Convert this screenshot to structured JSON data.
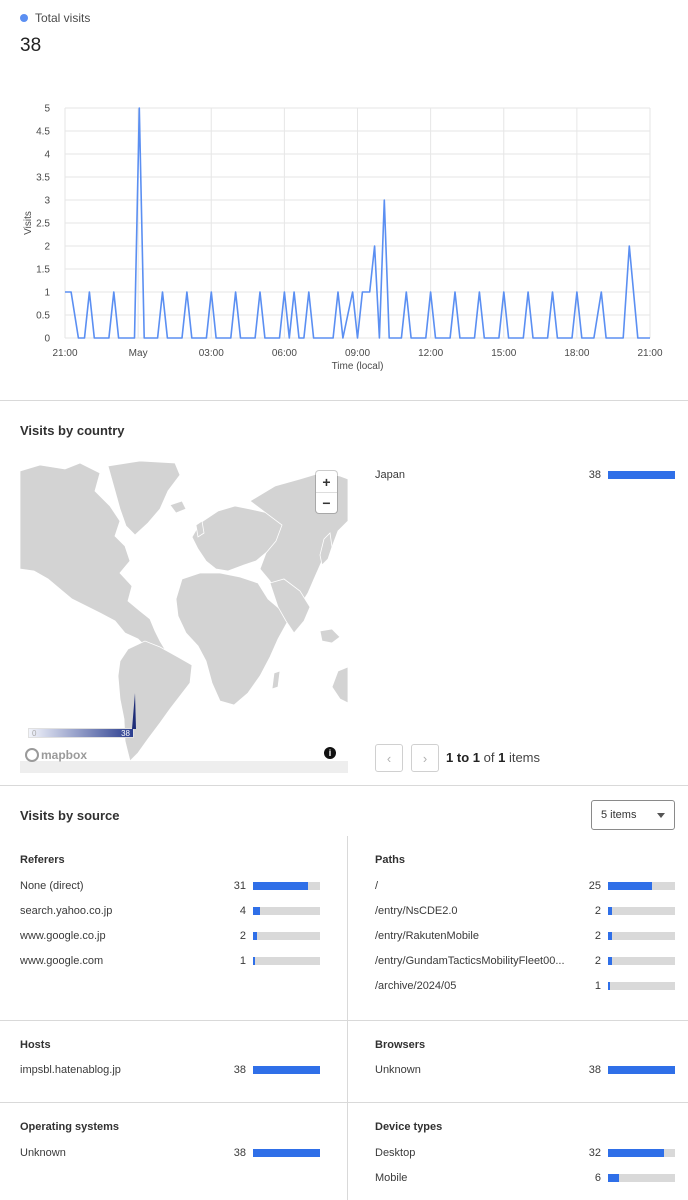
{
  "summary": {
    "legend_label": "Total visits",
    "total": "38",
    "accent": "#5b8ff2"
  },
  "chart_data": {
    "type": "line",
    "title": "",
    "xlabel": "Time (local)",
    "ylabel": "Visits",
    "ylim": [
      0,
      5
    ],
    "yticks": [
      "0",
      "0.5",
      "1",
      "1.5",
      "2",
      "2.5",
      "3",
      "3.5",
      "4",
      "4.5",
      "5"
    ],
    "xticks": [
      "21:00",
      "May",
      "03:00",
      "06:00",
      "09:00",
      "12:00",
      "15:00",
      "18:00",
      "21:00"
    ],
    "xrange_hours": [
      0,
      24
    ],
    "grid": true,
    "series": [
      {
        "color": "#5b8ff2",
        "points": [
          [
            0,
            1
          ],
          [
            0.25,
            1
          ],
          [
            0.55,
            0
          ],
          [
            0.8,
            0
          ],
          [
            1.0,
            1
          ],
          [
            1.2,
            0
          ],
          [
            1.8,
            0
          ],
          [
            2.0,
            1
          ],
          [
            2.2,
            0
          ],
          [
            2.85,
            0
          ],
          [
            3.05,
            5
          ],
          [
            3.25,
            0
          ],
          [
            3.8,
            0
          ],
          [
            4.0,
            1
          ],
          [
            4.2,
            0
          ],
          [
            4.8,
            0
          ],
          [
            5.0,
            1
          ],
          [
            5.2,
            0
          ],
          [
            5.8,
            0
          ],
          [
            6.0,
            1
          ],
          [
            6.2,
            0
          ],
          [
            6.8,
            0
          ],
          [
            7.0,
            1
          ],
          [
            7.2,
            0
          ],
          [
            7.8,
            0
          ],
          [
            8.0,
            1
          ],
          [
            8.2,
            0
          ],
          [
            8.8,
            0
          ],
          [
            9.0,
            1
          ],
          [
            9.2,
            0
          ],
          [
            9.4,
            1
          ],
          [
            9.6,
            0
          ],
          [
            9.8,
            0
          ],
          [
            10.0,
            1
          ],
          [
            10.2,
            0
          ],
          [
            11.0,
            0
          ],
          [
            11.2,
            1
          ],
          [
            11.4,
            0
          ],
          [
            11.8,
            1
          ],
          [
            12.0,
            0
          ],
          [
            12.2,
            1
          ],
          [
            12.5,
            1
          ],
          [
            12.7,
            2
          ],
          [
            12.9,
            0
          ],
          [
            13.1,
            3
          ],
          [
            13.3,
            0
          ],
          [
            13.8,
            0
          ],
          [
            14.0,
            1
          ],
          [
            14.2,
            0
          ],
          [
            14.8,
            0
          ],
          [
            15.0,
            1
          ],
          [
            15.2,
            0
          ],
          [
            15.8,
            0
          ],
          [
            16.0,
            1
          ],
          [
            16.2,
            0
          ],
          [
            16.8,
            0
          ],
          [
            17.0,
            1
          ],
          [
            17.2,
            0
          ],
          [
            17.8,
            0
          ],
          [
            18.0,
            1
          ],
          [
            18.2,
            0
          ],
          [
            18.8,
            0
          ],
          [
            19.0,
            1
          ],
          [
            19.2,
            0
          ],
          [
            19.8,
            0
          ],
          [
            20.0,
            1
          ],
          [
            20.2,
            0
          ],
          [
            20.8,
            0
          ],
          [
            21.0,
            1
          ],
          [
            21.2,
            0
          ],
          [
            21.7,
            0
          ],
          [
            22.0,
            1
          ],
          [
            22.2,
            0
          ],
          [
            22.9,
            0
          ],
          [
            23.15,
            2
          ],
          [
            23.5,
            0
          ],
          [
            24,
            0
          ]
        ]
      }
    ]
  },
  "country": {
    "title": "Visits by country",
    "zoom_in": "+",
    "zoom_out": "−",
    "scale_min": "0",
    "scale_max": "38",
    "map_logo": "mapbox",
    "rows": [
      {
        "label": "Japan",
        "value": "38",
        "fraction": 1.0
      }
    ],
    "pager": {
      "prev": "‹",
      "next": "›",
      "from": "1",
      "to_word": "to",
      "to": "1",
      "of_word": "of",
      "total": "1",
      "items_word": "items"
    }
  },
  "source": {
    "title": "Visits by source",
    "select_value": "5 items",
    "referers": {
      "title": "Referers",
      "rows": [
        {
          "label": "None (direct)",
          "value": "31",
          "fraction": 0.816
        },
        {
          "label": "search.yahoo.co.jp",
          "value": "4",
          "fraction": 0.105
        },
        {
          "label": "www.google.co.jp",
          "value": "2",
          "fraction": 0.053
        },
        {
          "label": "www.google.com",
          "value": "1",
          "fraction": 0.026
        }
      ]
    },
    "paths": {
      "title": "Paths",
      "rows": [
        {
          "label": "/",
          "value": "25",
          "fraction": 0.658
        },
        {
          "label": "/entry/NsCDE2.0",
          "value": "2",
          "fraction": 0.053
        },
        {
          "label": "/entry/RakutenMobile",
          "value": "2",
          "fraction": 0.053
        },
        {
          "label": "/entry/GundamTacticsMobilityFleet00...",
          "value": "2",
          "fraction": 0.053
        },
        {
          "label": "/archive/2024/05",
          "value": "1",
          "fraction": 0.026
        }
      ]
    },
    "hosts": {
      "title": "Hosts",
      "rows": [
        {
          "label": "impsbl.hatenablog.jp",
          "value": "38",
          "fraction": 1.0
        }
      ]
    },
    "browsers": {
      "title": "Browsers",
      "rows": [
        {
          "label": "Unknown",
          "value": "38",
          "fraction": 1.0
        }
      ]
    },
    "os": {
      "title": "Operating systems",
      "rows": [
        {
          "label": "Unknown",
          "value": "38",
          "fraction": 1.0
        }
      ]
    },
    "devices": {
      "title": "Device types",
      "rows": [
        {
          "label": "Desktop",
          "value": "32",
          "fraction": 0.842
        },
        {
          "label": "Mobile",
          "value": "6",
          "fraction": 0.158
        }
      ]
    }
  }
}
